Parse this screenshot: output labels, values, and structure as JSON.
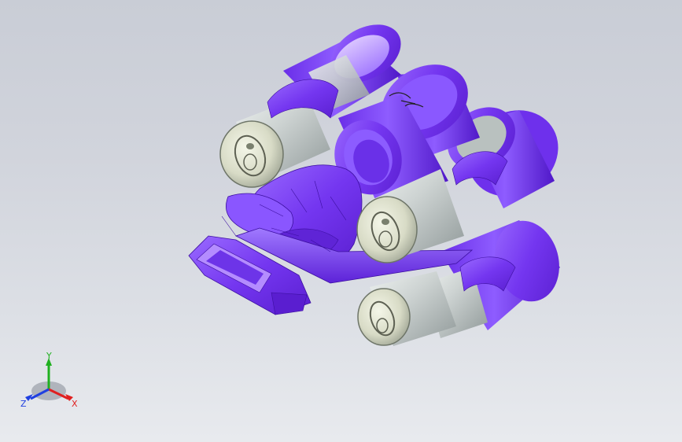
{
  "viewport": {
    "name": "cad-graphics-area",
    "model": "six-pack-can-holder",
    "body_color": "#7b3cf0",
    "can_color": "#c8cfcf",
    "background_top": "#c9cdd6",
    "background_bottom": "#e8eaee"
  },
  "triad": {
    "x_label": "X",
    "y_label": "Y",
    "z_label": "Z",
    "x_color": "#e02020",
    "y_color": "#20b020",
    "z_color": "#2040e0"
  }
}
